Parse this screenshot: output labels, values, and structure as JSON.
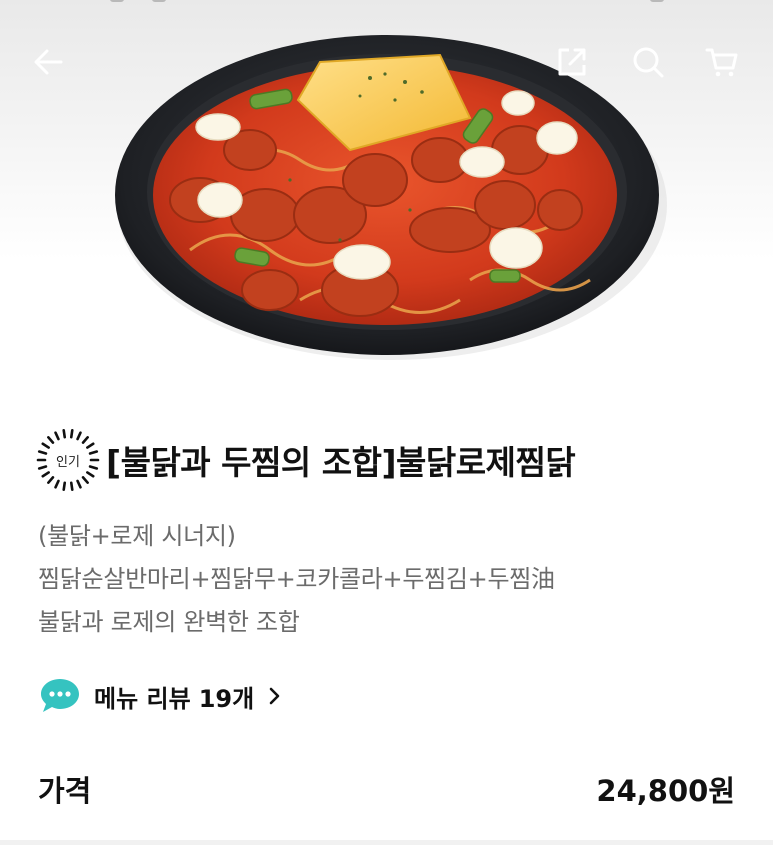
{
  "header": {
    "back_icon": "arrow-left-icon",
    "share_icon": "share-icon",
    "search_icon": "search-icon",
    "cart_icon": "cart-icon"
  },
  "hero": {
    "image": "dish-photo"
  },
  "product": {
    "badge": "인기",
    "title": "[불닭과 두찜의 조합]불닭로제찜닭",
    "description_lines": [
      "(불닭+로제 시너지)",
      "찜닭순살반마리+찜닭무+코카콜라+두찜김+두찜油",
      "불닭과 로제의 완벽한 조합"
    ]
  },
  "reviews": {
    "label": "메뉴 리뷰",
    "count": "19개",
    "icon": "speech-bubble-icon",
    "chevron": "chevron-right-icon"
  },
  "price": {
    "label": "가격",
    "value": "24,800원"
  },
  "colors": {
    "plate": "#1f2124",
    "sauce": "#d93a1e",
    "cheese": "#f6c23e",
    "review_icon": "#35c3c0"
  }
}
